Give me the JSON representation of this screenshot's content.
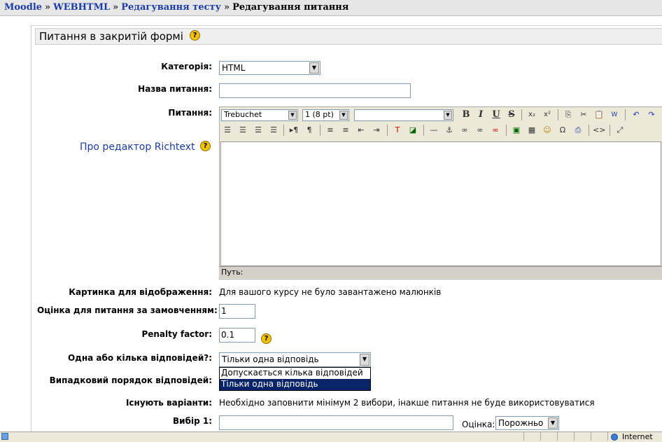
{
  "breadcrumb": {
    "items": [
      "Moodle",
      "WEBHTML",
      "Редагування тесту"
    ],
    "separator": "»",
    "current": "Редагування питання"
  },
  "section": {
    "title": "Питання в закритій формі"
  },
  "form": {
    "category_label": "Категорія:",
    "category_value": "HTML",
    "name_label": "Назва питання:",
    "name_value": "",
    "question_label": "Питання:",
    "richtext_help_link": "Про редактор Richtext",
    "editor": {
      "font": "Trebuchet",
      "size": "1 (8 pt)",
      "style": "",
      "path_label": "Путь:",
      "toolbar_row1": [
        "B",
        "I",
        "U",
        "S",
        "x₂",
        "x²",
        "copy",
        "cut",
        "paste",
        "word",
        "undo",
        "redo"
      ],
      "toolbar_row2": [
        "align-left",
        "align-center",
        "align-right",
        "justify",
        "ltr",
        "rtl",
        "ordered-list",
        "unordered-list",
        "outdent",
        "indent",
        "text-color",
        "bg-color",
        "hr",
        "anchor",
        "link",
        "unlink",
        "nolink",
        "image",
        "table",
        "smiley",
        "special-char",
        "paste-text",
        "html",
        "fullscreen"
      ]
    },
    "image_label": "Картинка для відображення:",
    "image_text": "Для вашого курсу не було завантажено малюнків",
    "default_grade_label": "Оцінка для питання за замовченням:",
    "default_grade_value": "1",
    "penalty_label": "Penalty factor:",
    "penalty_value": "0.1",
    "single_label": "Одна або кілька відповідей?:",
    "single_value": "Тільки одна відповідь",
    "single_options": [
      "Допускається кілька відповідей",
      "Тільки одна відповідь"
    ],
    "shuffle_label": "Випадковий порядок відповідей:",
    "variants_label": "Існують варіанти:",
    "variants_text": "Необхідно заповнити мінімум 2 вибори, інакше питання не буде використовуватися",
    "choice1_label": "Вибір 1:",
    "choice1_value": "",
    "grade_label": "Оцінка:",
    "grade_value": "Порожньо"
  },
  "statusbar": {
    "zone": "Internet"
  },
  "colors": {
    "link": "#1a3ca8",
    "highlight": "#0a246a",
    "help": "#f2c200"
  }
}
